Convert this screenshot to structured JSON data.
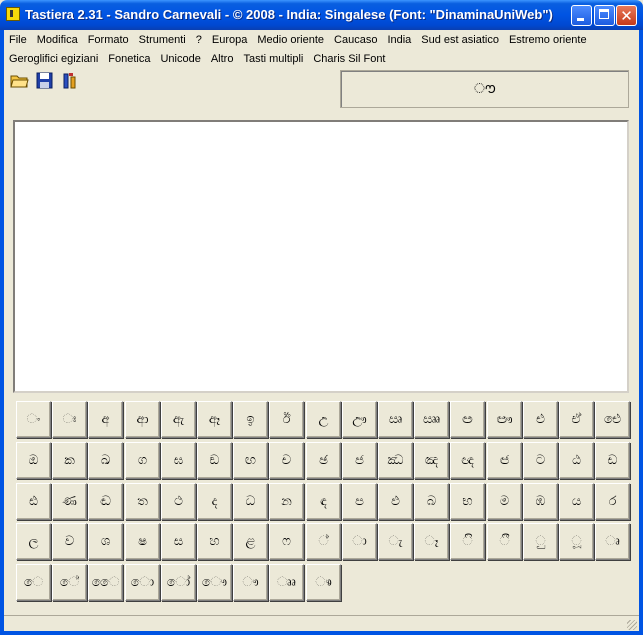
{
  "window": {
    "title": "Tastiera 2.31 - Sandro Carnevali - ©  2008 - India: Singalese (Font: \"DinaminaUniWeb\")",
    "close_glyph": "✕"
  },
  "menu_row1": [
    "File",
    "Modifica",
    "Formato",
    "Strumenti",
    "?",
    "Europa",
    "Medio oriente",
    "Caucaso",
    "India",
    "Sud est asiatico",
    "Estremo oriente"
  ],
  "menu_row2": [
    "Geroglifici egiziani",
    "Fonetica",
    "Unicode",
    "Altro",
    "Tasti multipli",
    "Charis Sil Font"
  ],
  "toolbar": {
    "icons": [
      "open-folder-icon",
      "save-disk-icon",
      "tool-icon"
    ]
  },
  "preview": {
    "char": "ൗ"
  },
  "editor": {
    "text": ""
  },
  "keyboard": {
    "rows": [
      [
        "ං",
        "ඃ",
        "අ",
        "ආ",
        "ඇ",
        "ඈ",
        "ඉ",
        "ඊ",
        "උ",
        "ඌ",
        "ඍ",
        "ඎ",
        "ඏ",
        "ඐ",
        "එ",
        "ඒ",
        "ඓ"
      ],
      [
        "ඔ",
        "ක",
        "ඛ",
        "ග",
        "ඝ",
        "ඞ",
        "ඟ",
        "ච",
        "ඡ",
        "ජ",
        "ඣ",
        "ඤ",
        "ඥ",
        "ඦ",
        "ට",
        "ඨ",
        "ඩ"
      ],
      [
        "ඪ",
        "ණ",
        "ඬ",
        "ත",
        "ථ",
        "ද",
        "ධ",
        "න",
        "ඳ",
        "ප",
        "ඵ",
        "බ",
        "භ",
        "ම",
        "ඹ",
        "ය",
        "ර"
      ],
      [
        "ල",
        "ව",
        "ශ",
        "ෂ",
        "ස",
        "හ",
        "ළ",
        "ෆ",
        "්",
        "ා",
        "ැ",
        "ෑ",
        "ි",
        "ී",
        "ු",
        "ූ",
        "ෘ"
      ],
      [
        "ෙ",
        "ේ",
        "ෛ",
        "ො",
        "ෝ",
        "ෞ",
        "ෟ",
        "ෲ",
        "ෳ"
      ]
    ]
  },
  "status": {
    "text": ""
  }
}
